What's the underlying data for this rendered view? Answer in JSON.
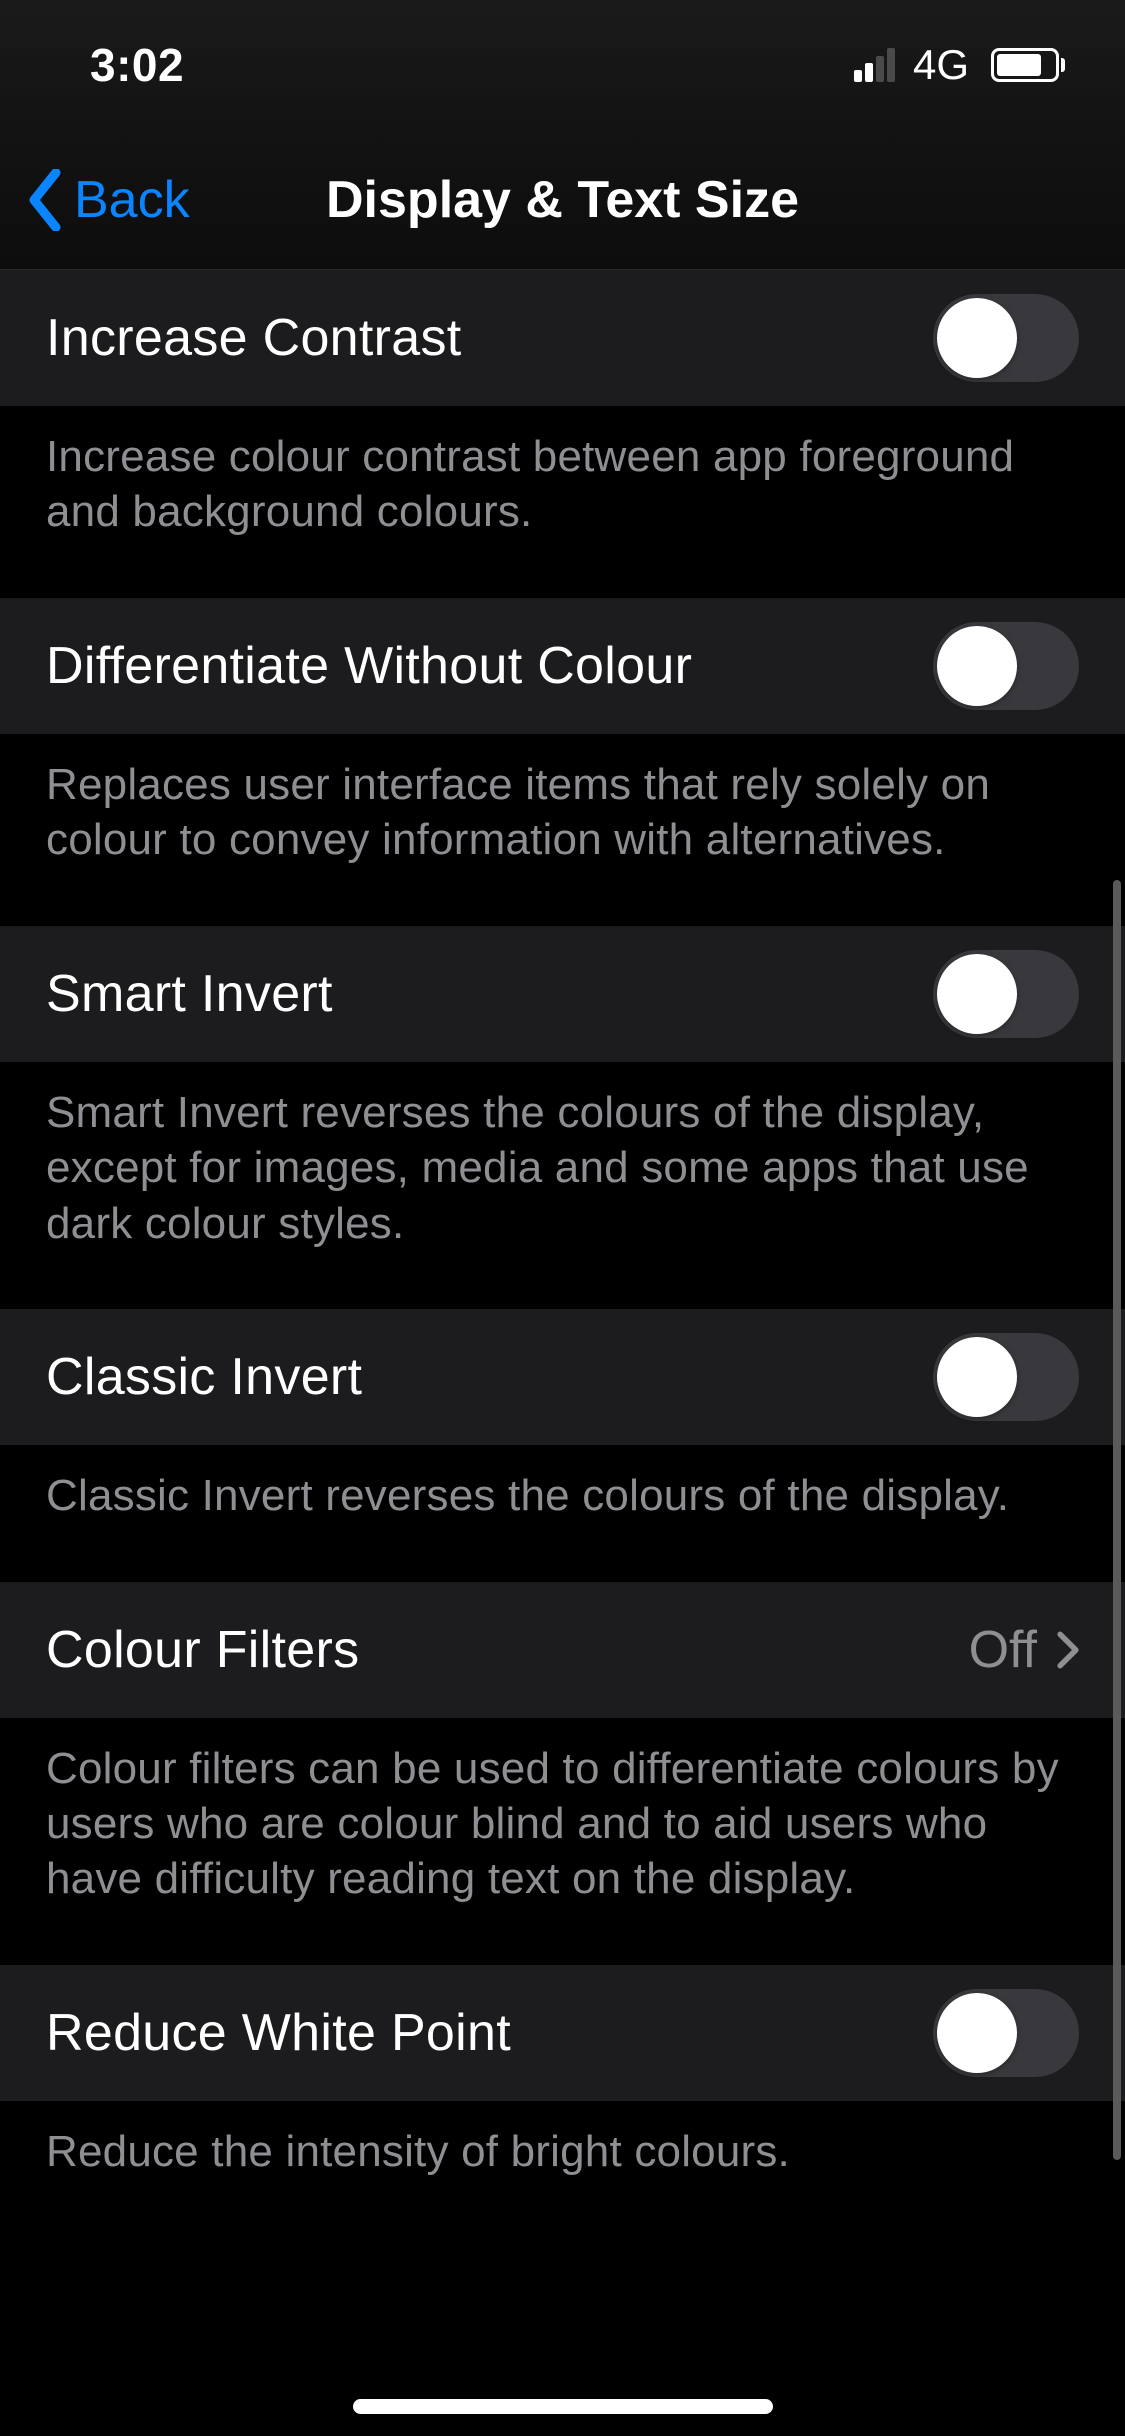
{
  "status_bar": {
    "time": "3:02",
    "network_type": "4G"
  },
  "nav": {
    "back_label": "Back",
    "title": "Display & Text Size"
  },
  "sections": [
    {
      "id": "increase_contrast",
      "label": "Increase Contrast",
      "type": "toggle",
      "value": false,
      "footer": "Increase colour contrast between app foreground and background colours."
    },
    {
      "id": "differentiate_without_colour",
      "label": "Differentiate Without Colour",
      "type": "toggle",
      "value": false,
      "footer": "Replaces user interface items that rely solely on colour to convey information with alternatives."
    },
    {
      "id": "smart_invert",
      "label": "Smart Invert",
      "type": "toggle",
      "value": false,
      "footer": "Smart Invert reverses the colours of the display, except for images, media and some apps that use dark colour styles."
    },
    {
      "id": "classic_invert",
      "label": "Classic Invert",
      "type": "toggle",
      "value": false,
      "footer": "Classic Invert reverses the colours of the display."
    },
    {
      "id": "colour_filters",
      "label": "Colour Filters",
      "type": "disclosure",
      "value_text": "Off",
      "footer": "Colour filters can be used to differentiate colours by users who are colour blind and to aid users who have difficulty reading text on the display."
    },
    {
      "id": "reduce_white_point",
      "label": "Reduce White Point",
      "type": "toggle",
      "value": false,
      "footer": "Reduce the intensity of bright colours."
    }
  ]
}
